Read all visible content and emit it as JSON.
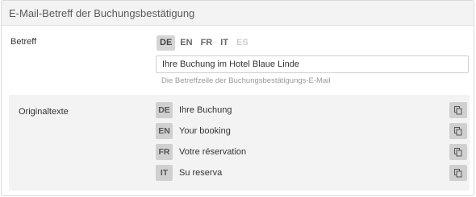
{
  "panel": {
    "title": "E-Mail-Betreff der Buchungsbestätigung"
  },
  "subject": {
    "label": "Betreff",
    "languages": [
      {
        "code": "DE",
        "state": "active"
      },
      {
        "code": "EN",
        "state": "normal"
      },
      {
        "code": "FR",
        "state": "normal"
      },
      {
        "code": "IT",
        "state": "normal"
      },
      {
        "code": "ES",
        "state": "disabled"
      }
    ],
    "value": "Ihre Buchung im Hotel Blaue Linde",
    "help": "Die Betreffzeile der Buchungsbestätigungs-E-Mail"
  },
  "originals": {
    "label": "Originaltexte",
    "rows": [
      {
        "code": "DE",
        "text": "Ihre Buchung",
        "icon": "copy-icon"
      },
      {
        "code": "EN",
        "text": "Your booking",
        "icon": "copy-icon"
      },
      {
        "code": "FR",
        "text": "Votre réservation",
        "icon": "copy-icon"
      },
      {
        "code": "IT",
        "text": "Su reserva",
        "icon": "copy-icon"
      }
    ]
  }
}
